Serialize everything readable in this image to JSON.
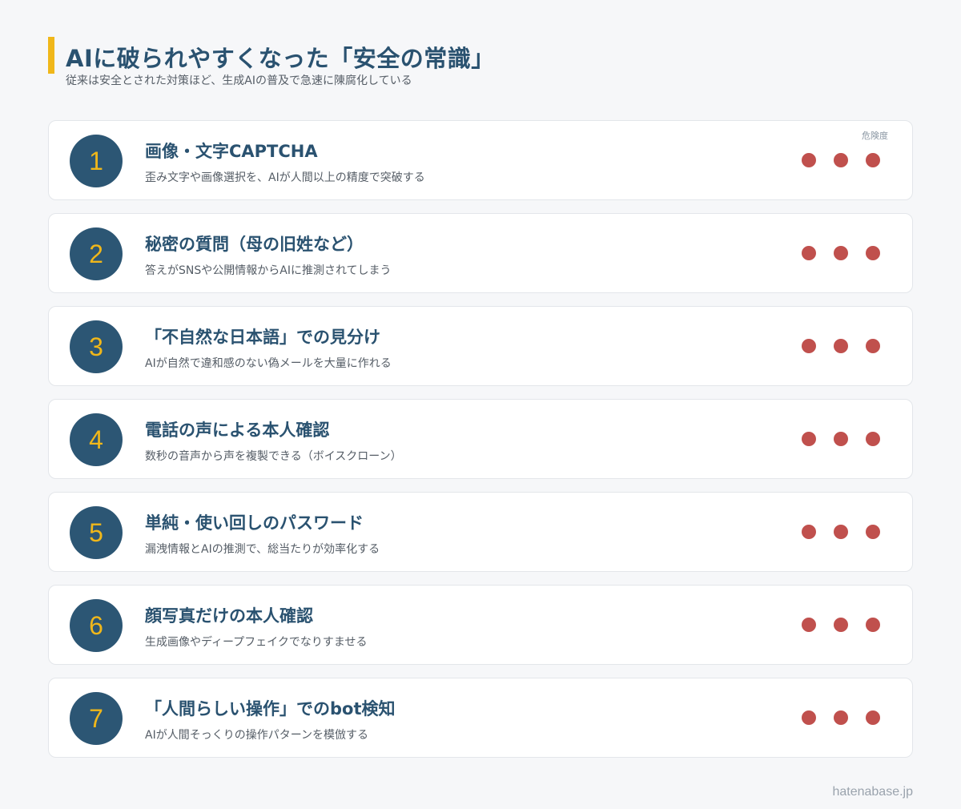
{
  "header": {
    "title": "AIに破られやすくなった「安全の常識」",
    "subtitle": "従来は安全とされた対策ほど、生成AIの普及で急速に陳腐化している"
  },
  "risk_label": "危険度",
  "accent_color": "#f0b71a",
  "number_circle_color": "#2c5674",
  "risk_dot_color": "#c0504d",
  "items": [
    {
      "number": "1",
      "title": "画像・文字CAPTCHA",
      "description": "歪み文字や画像選択を、AIが人間以上の精度で突破する",
      "risk_level": 3
    },
    {
      "number": "2",
      "title": "秘密の質問（母の旧姓など）",
      "description": "答えがSNSや公開情報からAIに推測されてしまう",
      "risk_level": 3
    },
    {
      "number": "3",
      "title": "「不自然な日本語」での見分け",
      "description": "AIが自然で違和感のない偽メールを大量に作れる",
      "risk_level": 3
    },
    {
      "number": "4",
      "title": "電話の声による本人確認",
      "description": "数秒の音声から声を複製できる（ボイスクローン）",
      "risk_level": 3
    },
    {
      "number": "5",
      "title": "単純・使い回しのパスワード",
      "description": "漏洩情報とAIの推測で、総当たりが効率化する",
      "risk_level": 3
    },
    {
      "number": "6",
      "title": "顔写真だけの本人確認",
      "description": "生成画像やディープフェイクでなりすませる",
      "risk_level": 3
    },
    {
      "number": "7",
      "title": "「人間らしい操作」でのbot検知",
      "description": "AIが人間そっくりの操作パターンを模倣する",
      "risk_level": 3
    }
  ],
  "footer": {
    "site": "hatenabase.jp"
  }
}
